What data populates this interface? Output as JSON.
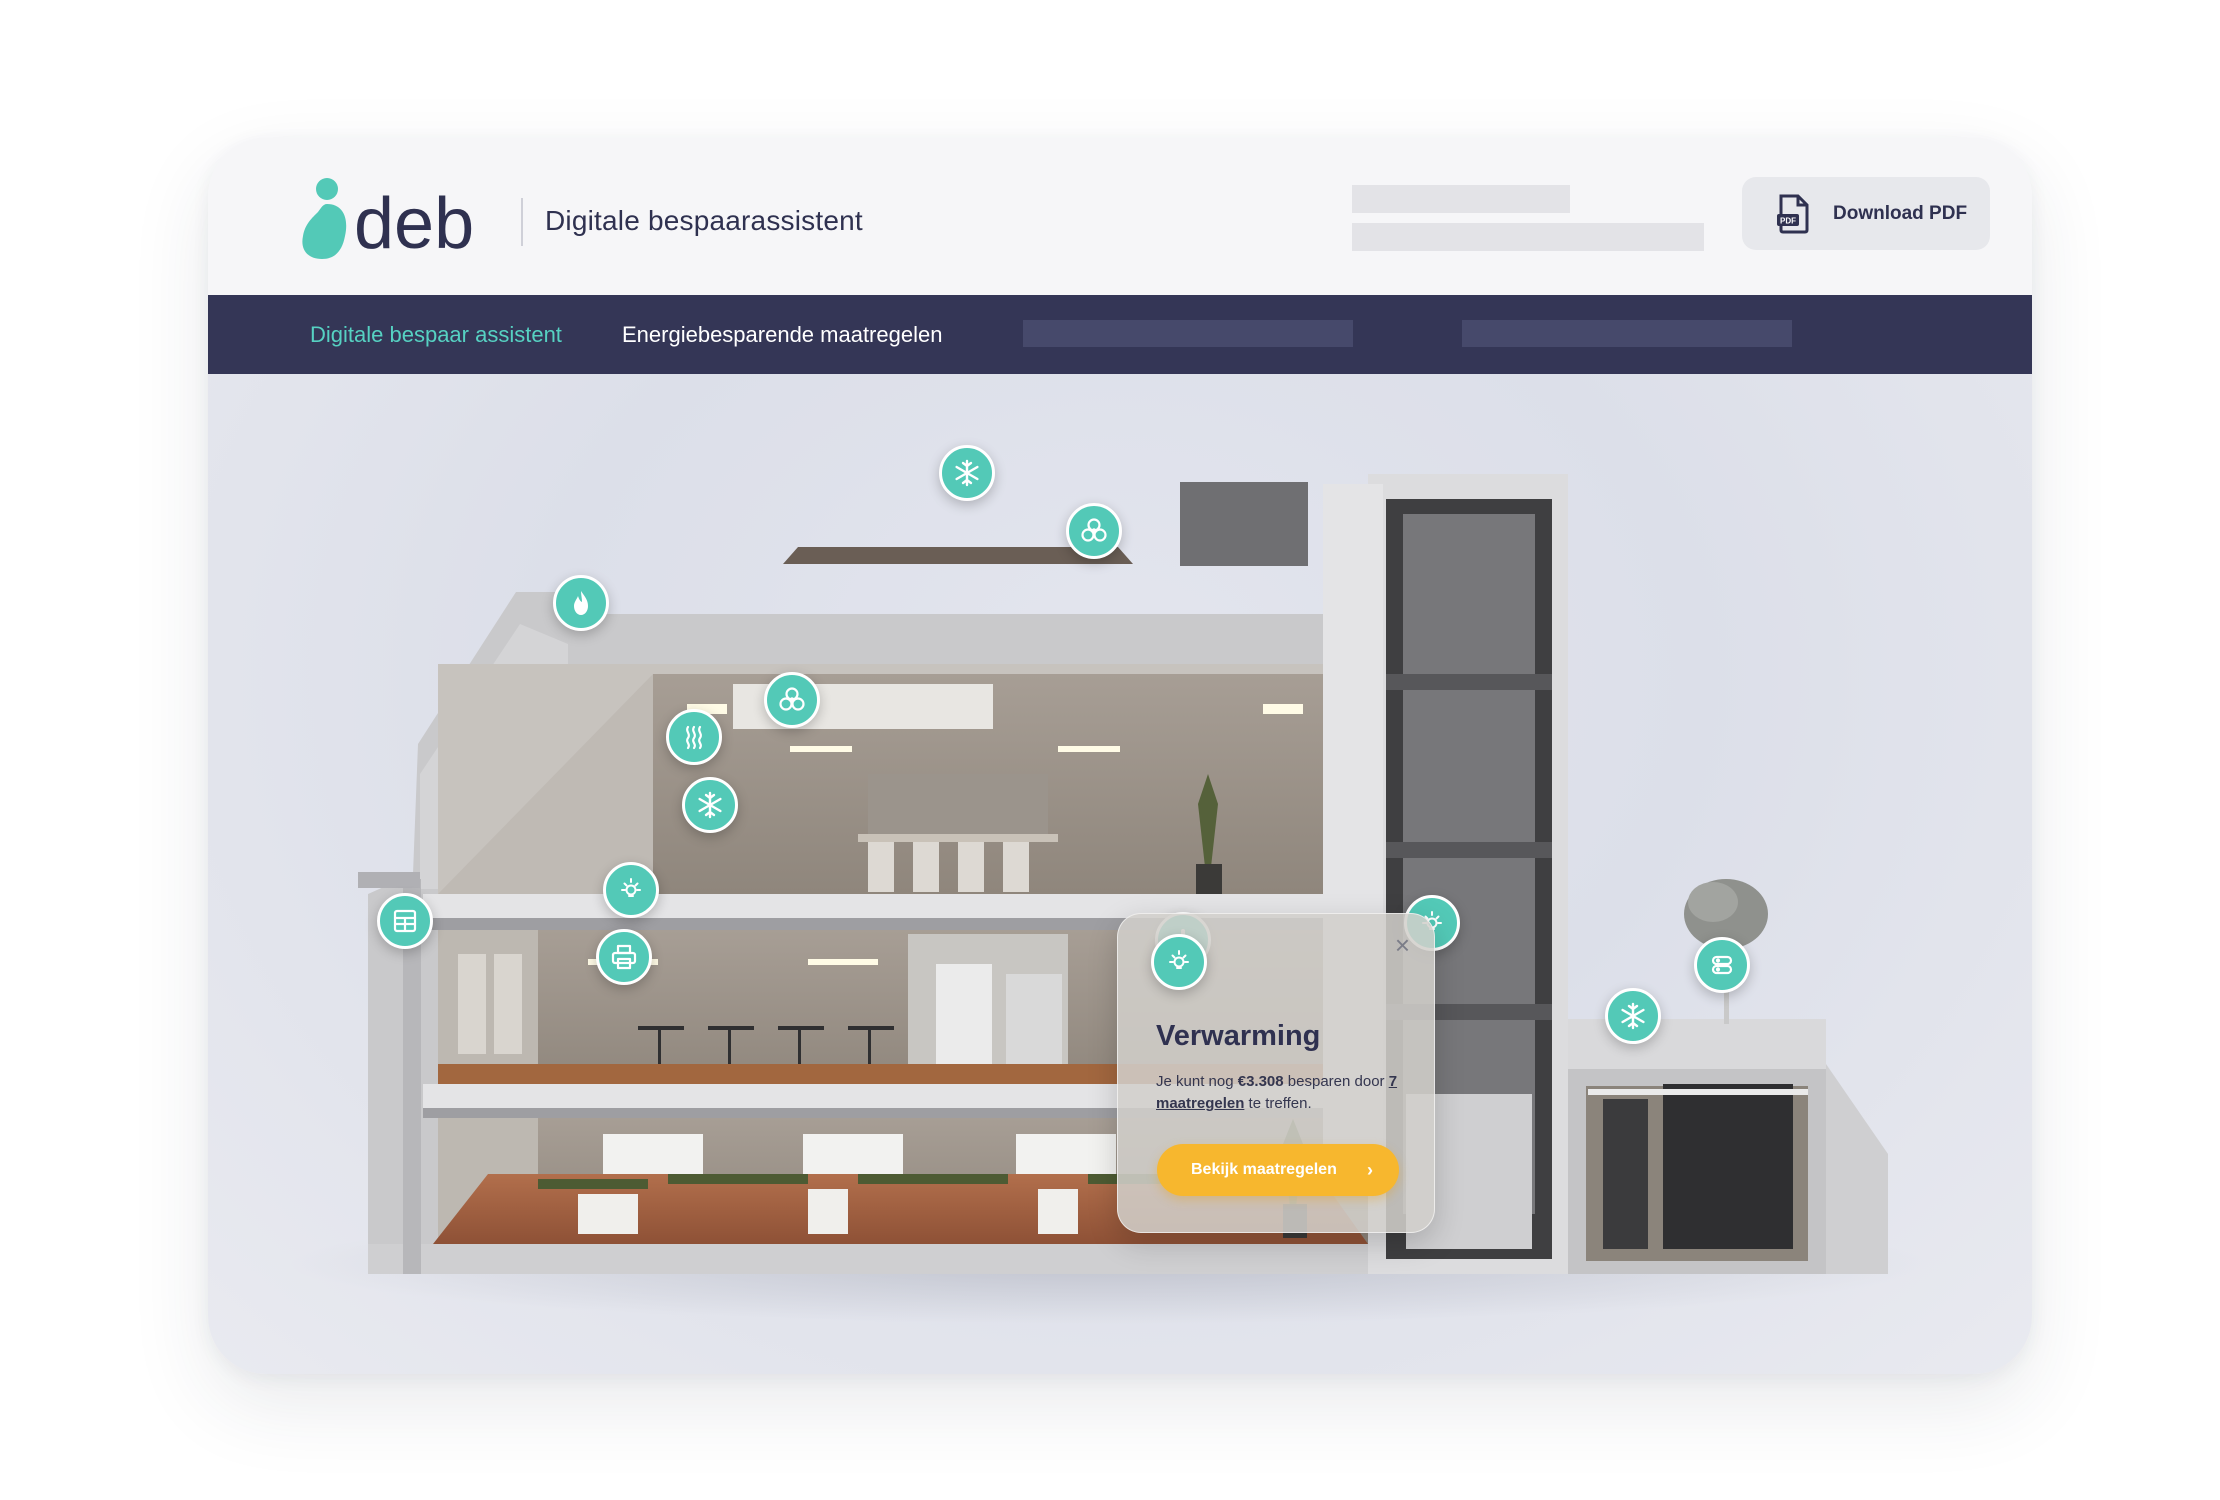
{
  "header": {
    "logo_text": "deb",
    "subtitle": "Digitale bespaarassistent",
    "download_label": "Download PDF"
  },
  "nav": {
    "items": [
      {
        "label": "Digitale bespaar assistent",
        "active": true
      },
      {
        "label": "Energiebesparende maatregelen",
        "active": false
      }
    ]
  },
  "popup": {
    "icon": "bulb-icon",
    "title": "Verwarming",
    "text_before": "Je kunt nog ",
    "amount": "€3.308",
    "text_middle": " besparen door ",
    "link": "7 maatregelen",
    "text_after": " te treffen.",
    "cta_label": "Bekijk maatregelen",
    "cta_chevron": "›",
    "close_symbol": "×"
  },
  "hotspots": [
    "snowflake-icon",
    "fan-icon",
    "flame-icon",
    "fan-icon",
    "heat-icon",
    "snowflake-icon",
    "bulb-icon",
    "window-icon",
    "printer-icon",
    "thermometer-icon",
    "bulb-icon",
    "server-icon",
    "snowflake-icon"
  ],
  "colors": {
    "brand_teal": "#53c9b7",
    "nav_bg": "#343656",
    "nav_active": "#56d1c2",
    "cta": "#f7b72e",
    "text_dark": "#2f3150"
  }
}
